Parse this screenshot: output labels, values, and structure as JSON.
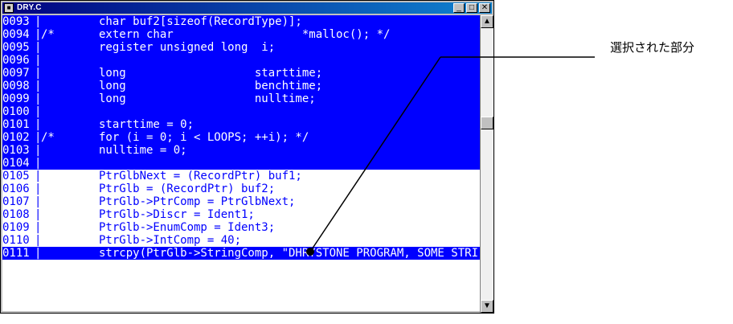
{
  "window": {
    "title": "DRY.C",
    "icon_name": "document-icon",
    "buttons": {
      "minimize": "_",
      "maximize": "□",
      "close": "✕"
    }
  },
  "editor": {
    "lines": [
      {
        "number": "0093",
        "marker": "",
        "code": "char buf2[sizeof(RecordType)];",
        "selected": true
      },
      {
        "number": "0094",
        "marker": "/*",
        "code": "extern char                   *malloc(); */",
        "selected": true
      },
      {
        "number": "0095",
        "marker": "",
        "code": "register unsigned long  i;",
        "selected": true
      },
      {
        "number": "0096",
        "marker": "",
        "code": "",
        "selected": true
      },
      {
        "number": "0097",
        "marker": "",
        "code": "long                   starttime;",
        "selected": true
      },
      {
        "number": "0098",
        "marker": "",
        "code": "long                   benchtime;",
        "selected": true
      },
      {
        "number": "0099",
        "marker": "",
        "code": "long                   nulltime;",
        "selected": true
      },
      {
        "number": "0100",
        "marker": "",
        "code": "",
        "selected": true
      },
      {
        "number": "0101",
        "marker": "",
        "code": "starttime = 0;",
        "selected": true
      },
      {
        "number": "0102",
        "marker": "/*",
        "code": "for (i = 0; i < LOOPS; ++i); */",
        "selected": true
      },
      {
        "number": "0103",
        "marker": "",
        "code": "nulltime = 0;",
        "selected": true
      },
      {
        "number": "0104",
        "marker": "",
        "code": "",
        "selected": true
      },
      {
        "number": "0105",
        "marker": "",
        "code": "PtrGlbNext = (RecordPtr) buf1;",
        "selected": false
      },
      {
        "number": "0106",
        "marker": "",
        "code": "PtrGlb = (RecordPtr) buf2;",
        "selected": false
      },
      {
        "number": "0107",
        "marker": "",
        "code": "PtrGlb->PtrComp = PtrGlbNext;",
        "selected": false
      },
      {
        "number": "0108",
        "marker": "",
        "code": "PtrGlb->Discr = Ident1;",
        "selected": false
      },
      {
        "number": "0109",
        "marker": "",
        "code": "PtrGlb->EnumComp = Ident3;",
        "selected": false
      },
      {
        "number": "0110",
        "marker": "",
        "code": "PtrGlb->IntComp = 40;",
        "selected": false
      },
      {
        "number": "0111",
        "marker": "",
        "code": "strcpy(PtrGlb->StringComp, \"DHRYSTONE PROGRAM, SOME STRI",
        "selected": true
      }
    ]
  },
  "scrollbar": {
    "up_arrow": "▲",
    "down_arrow": "▼"
  },
  "callout": {
    "label": "選択された部分"
  },
  "colors": {
    "selection_bg": "#0000ff",
    "selection_fg": "#ffffff",
    "unselected_fg": "#0000ff"
  }
}
